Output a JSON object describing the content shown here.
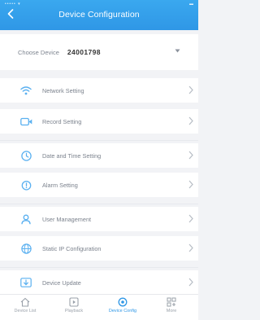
{
  "header": {
    "title": "Device Configuration"
  },
  "device_selector": {
    "label": "Choose Device",
    "value": "24001798"
  },
  "menu": {
    "items": [
      {
        "label": "Network Setting",
        "icon": "wifi-icon"
      },
      {
        "label": "Record Setting",
        "icon": "record-icon"
      },
      {
        "label": "Date and Time Setting",
        "icon": "clock-icon"
      },
      {
        "label": "Alarm Setting",
        "icon": "alarm-icon"
      },
      {
        "label": "User Management",
        "icon": "user-icon"
      },
      {
        "label": "Static IP Configuration",
        "icon": "globe-icon"
      },
      {
        "label": "Device Update",
        "icon": "update-icon"
      }
    ]
  },
  "tabs": [
    {
      "label": "Device List",
      "icon": "home-icon"
    },
    {
      "label": "Playback",
      "icon": "playback-icon"
    },
    {
      "label": "Device Config",
      "icon": "settings-icon"
    },
    {
      "label": "More",
      "icon": "more-icon"
    }
  ],
  "colors": {
    "accent": "#2f97e6",
    "icon_blue": "#5ab0f0",
    "background": "#f2f3f6"
  }
}
